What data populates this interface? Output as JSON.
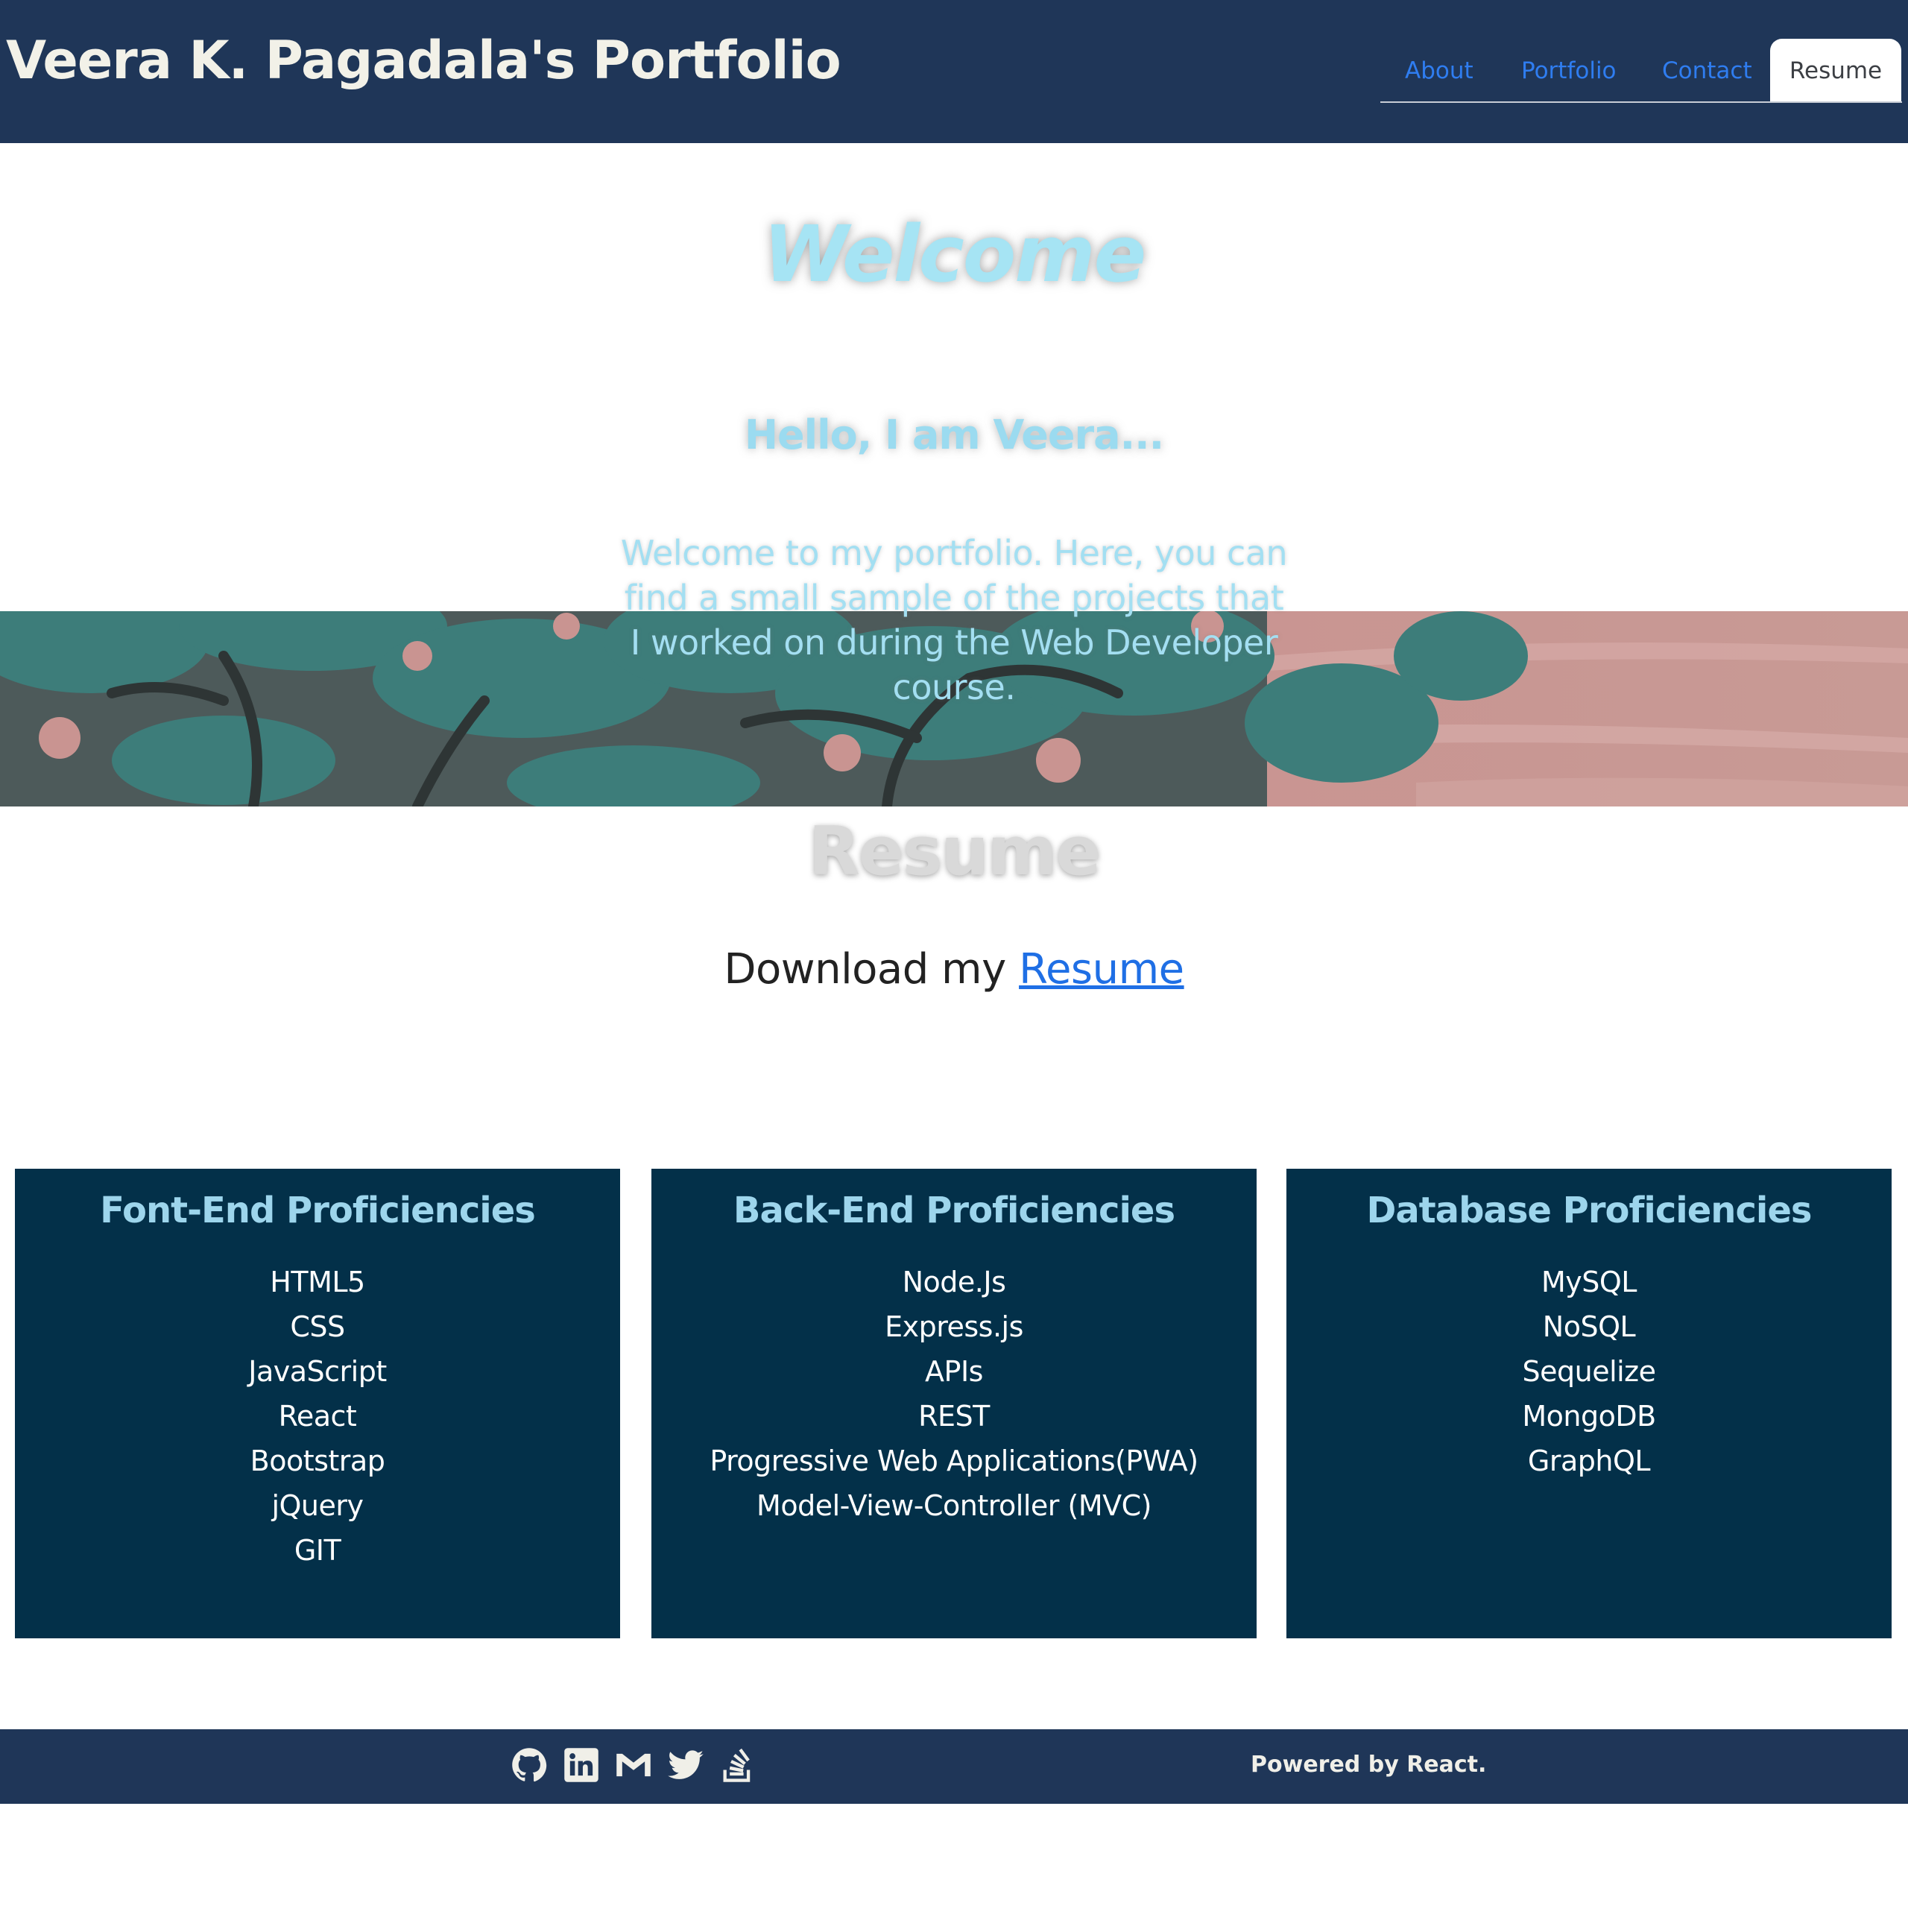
{
  "header": {
    "title": "Veera K. Pagadala's Portfolio",
    "nav": [
      "About",
      "Portfolio",
      "Contact"
    ],
    "active_nav": "Resume"
  },
  "hero": {
    "welcome": "Welcome",
    "hello": "Hello, I am Veera...",
    "intro": "Welcome to my portfolio. Here, you can find a small sample of the projects that I worked on during the Web Developer course."
  },
  "resume": {
    "title": "Resume",
    "download_text": "Download my",
    "download_link": "Resume"
  },
  "cards": [
    {
      "title": "Font-End Proficiencies",
      "items": [
        "HTML5",
        "CSS",
        "JavaScript",
        "React",
        "Bootstrap",
        "jQuery",
        "GIT"
      ]
    },
    {
      "title": "Back-End Proficiencies",
      "items": [
        "Node.Js",
        "Express.js",
        "APIs",
        "REST",
        "Progressive Web Applications(PWA)",
        "Model-View-Controller (MVC)"
      ]
    },
    {
      "title": "Database Proficiencies",
      "items": [
        "MySQL",
        "NoSQL",
        "Sequelize",
        "MongoDB",
        "GraphQL"
      ]
    }
  ],
  "footer": {
    "icons": [
      "github-icon",
      "linkedin-icon",
      "gmail-icon",
      "twitter-icon",
      "stackoverflow-icon"
    ],
    "powered": "Powered by React."
  },
  "colors": {
    "header_bg": "#1f3658",
    "card_bg": "#033049",
    "accent": "#9dd5ec",
    "link": "#2f7df0"
  }
}
